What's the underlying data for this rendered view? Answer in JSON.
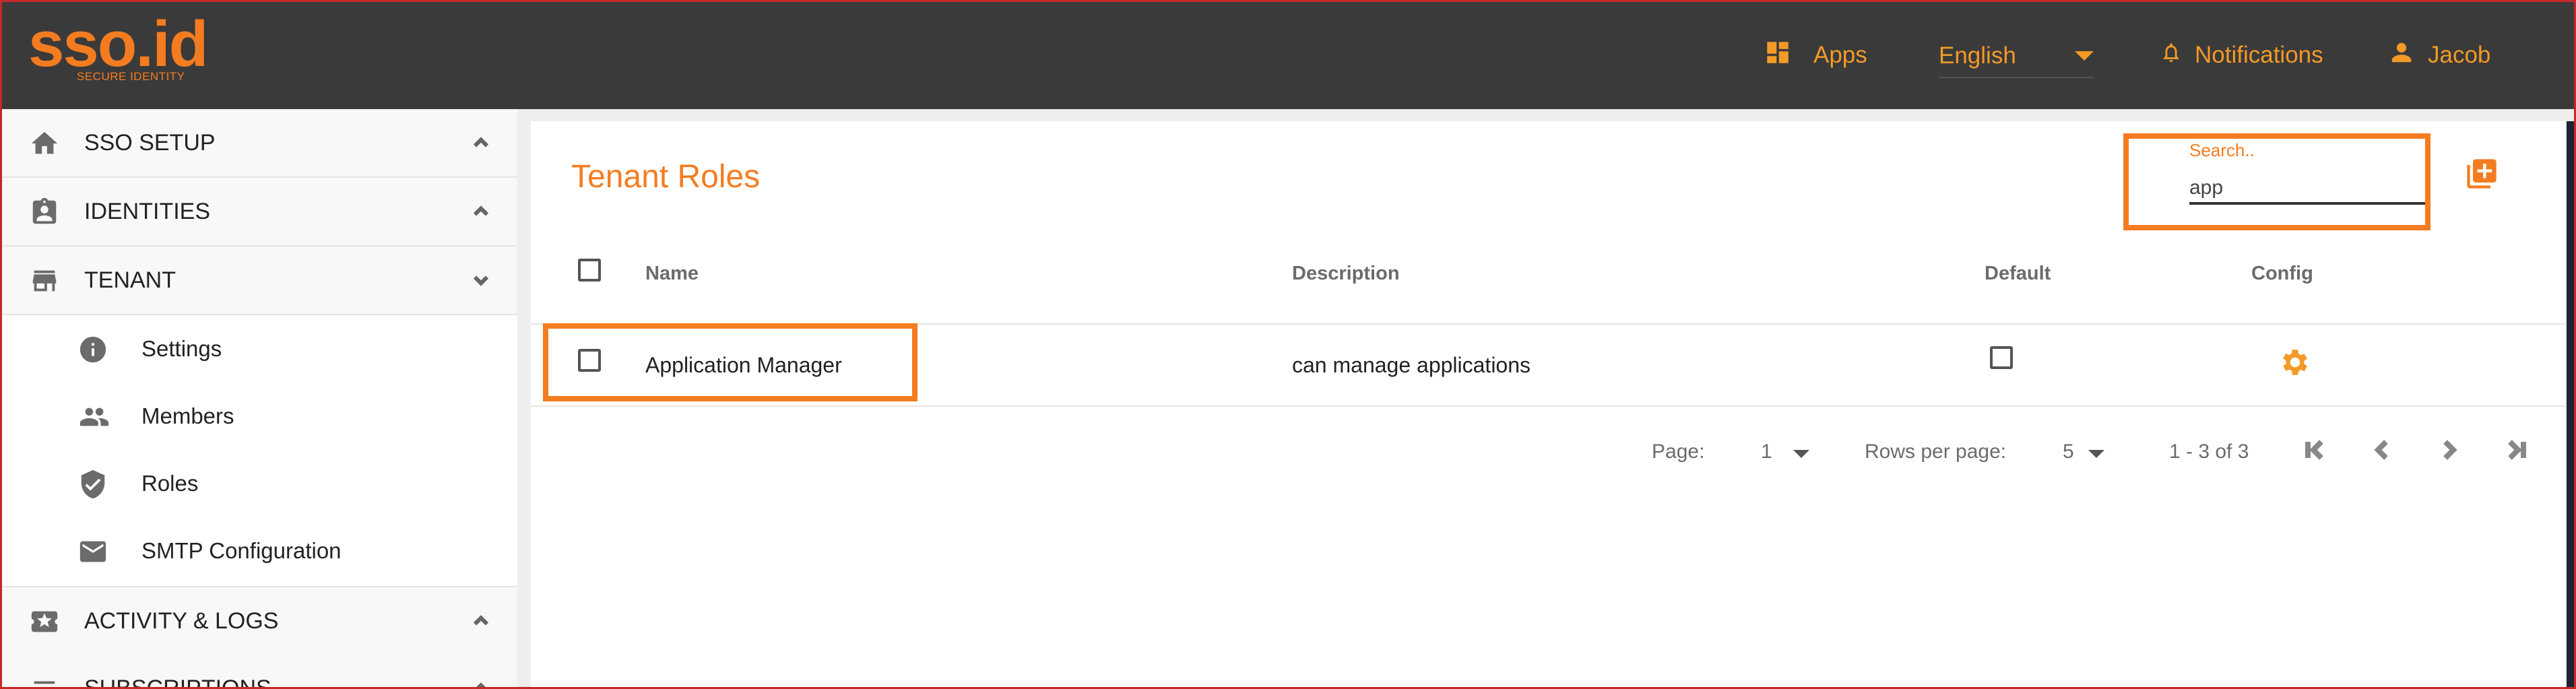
{
  "header": {
    "logo_text": "sso.id",
    "logo_tagline": "SECURE IDENTITY",
    "apps_label": "Apps",
    "language": "English",
    "notifications_label": "Notifications",
    "user_name": "Jacob"
  },
  "sidebar": {
    "sections": [
      {
        "label": "SSO SETUP",
        "icon": "home-icon"
      },
      {
        "label": "IDENTITIES",
        "icon": "badge-icon"
      },
      {
        "label": "TENANT",
        "icon": "store-icon"
      },
      {
        "label": "ACTIVITY & LOGS",
        "icon": "star-ticket-icon"
      },
      {
        "label": "SUBSCRIPTIONS",
        "icon": "list-icon"
      }
    ],
    "tenant_items": [
      {
        "label": "Settings",
        "icon": "info-icon"
      },
      {
        "label": "Members",
        "icon": "people-icon"
      },
      {
        "label": "Roles",
        "icon": "shield-check-icon"
      },
      {
        "label": "SMTP Configuration",
        "icon": "mail-icon"
      }
    ]
  },
  "main": {
    "title": "Tenant Roles",
    "search": {
      "label": "Search..",
      "value": "app"
    },
    "columns": [
      "Name",
      "Description",
      "Default",
      "Config"
    ],
    "rows": [
      {
        "name": "Application Manager",
        "description": "can manage applications",
        "default": false
      }
    ],
    "pagination": {
      "page_label": "Page:",
      "page_value": "1",
      "rows_label": "Rows per page:",
      "rows_value": "5",
      "range": "1 - 3 of 3"
    }
  },
  "colors": {
    "accent": "#f47c20",
    "header_bg": "#3a3a3a",
    "highlight": "#f47c20"
  }
}
